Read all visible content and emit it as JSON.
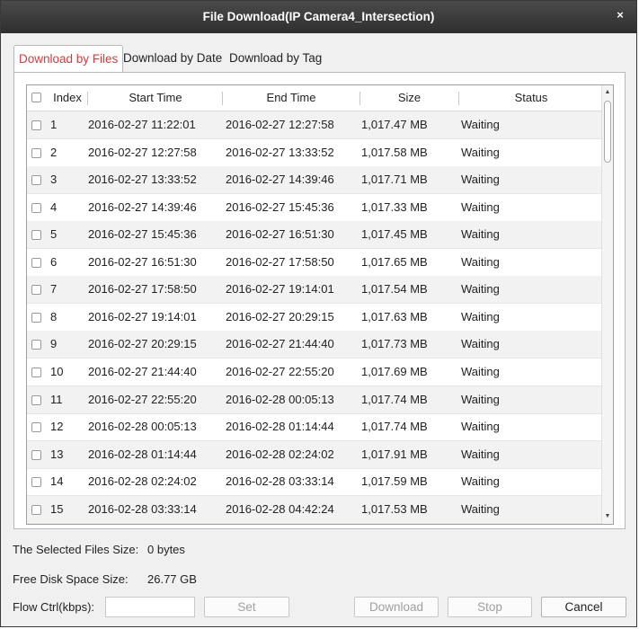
{
  "window": {
    "title": "File Download(IP Camera4_Intersection)",
    "close_glyph": "×"
  },
  "tabs": [
    {
      "label": "Download by Files",
      "active": true
    },
    {
      "label": "Download by Date",
      "active": false
    },
    {
      "label": "Download by Tag",
      "active": false
    }
  ],
  "table": {
    "columns": [
      "Index",
      "Start Time",
      "End Time",
      "Size",
      "Status"
    ],
    "rows": [
      {
        "index": "1",
        "start": "2016-02-27 11:22:01",
        "end": "2016-02-27 12:27:58",
        "size": "1,017.47 MB",
        "status": "Waiting"
      },
      {
        "index": "2",
        "start": "2016-02-27 12:27:58",
        "end": "2016-02-27 13:33:52",
        "size": "1,017.58 MB",
        "status": "Waiting"
      },
      {
        "index": "3",
        "start": "2016-02-27 13:33:52",
        "end": "2016-02-27 14:39:46",
        "size": "1,017.71 MB",
        "status": "Waiting"
      },
      {
        "index": "4",
        "start": "2016-02-27 14:39:46",
        "end": "2016-02-27 15:45:36",
        "size": "1,017.33 MB",
        "status": "Waiting"
      },
      {
        "index": "5",
        "start": "2016-02-27 15:45:36",
        "end": "2016-02-27 16:51:30",
        "size": "1,017.45 MB",
        "status": "Waiting"
      },
      {
        "index": "6",
        "start": "2016-02-27 16:51:30",
        "end": "2016-02-27 17:58:50",
        "size": "1,017.65 MB",
        "status": "Waiting"
      },
      {
        "index": "7",
        "start": "2016-02-27 17:58:50",
        "end": "2016-02-27 19:14:01",
        "size": "1,017.54 MB",
        "status": "Waiting"
      },
      {
        "index": "8",
        "start": "2016-02-27 19:14:01",
        "end": "2016-02-27 20:29:15",
        "size": "1,017.63 MB",
        "status": "Waiting"
      },
      {
        "index": "9",
        "start": "2016-02-27 20:29:15",
        "end": "2016-02-27 21:44:40",
        "size": "1,017.73 MB",
        "status": "Waiting"
      },
      {
        "index": "10",
        "start": "2016-02-27 21:44:40",
        "end": "2016-02-27 22:55:20",
        "size": "1,017.69 MB",
        "status": "Waiting"
      },
      {
        "index": "11",
        "start": "2016-02-27 22:55:20",
        "end": "2016-02-28 00:05:13",
        "size": "1,017.74 MB",
        "status": "Waiting"
      },
      {
        "index": "12",
        "start": "2016-02-28 00:05:13",
        "end": "2016-02-28 01:14:44",
        "size": "1,017.74 MB",
        "status": "Waiting"
      },
      {
        "index": "13",
        "start": "2016-02-28 01:14:44",
        "end": "2016-02-28 02:24:02",
        "size": "1,017.91 MB",
        "status": "Waiting"
      },
      {
        "index": "14",
        "start": "2016-02-28 02:24:02",
        "end": "2016-02-28 03:33:14",
        "size": "1,017.59 MB",
        "status": "Waiting"
      },
      {
        "index": "15",
        "start": "2016-02-28 03:33:14",
        "end": "2016-02-28 04:42:24",
        "size": "1,017.53 MB",
        "status": "Waiting"
      }
    ]
  },
  "footer": {
    "selected_size_label": "The Selected Files Size:",
    "selected_size_value": "0 bytes",
    "free_disk_label": "Free Disk Space Size:",
    "free_disk_value": "26.77 GB",
    "flow_ctrl_label": "Flow Ctrl(kbps):",
    "flow_ctrl_value": ""
  },
  "buttons": {
    "set": "Set",
    "download": "Download",
    "stop": "Stop",
    "cancel": "Cancel"
  },
  "colors": {
    "active_tab": "#d23c3c",
    "titlebar": "#3a3a3a",
    "alt_row": "#f2f2f2"
  },
  "icons": {
    "close": "close-icon",
    "scroll_up": "scroll-up-arrow-icon",
    "scroll_down": "scroll-down-arrow-icon"
  }
}
